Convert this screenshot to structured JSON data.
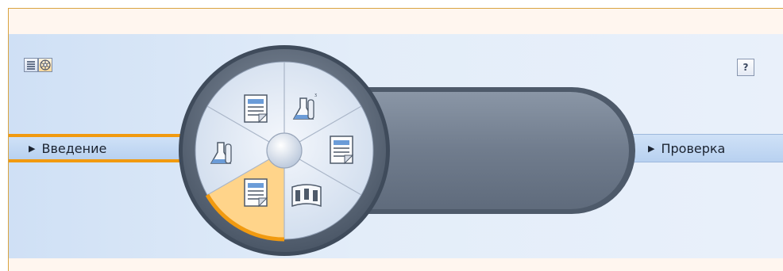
{
  "toolbar": {
    "list_view": "list-view",
    "wheel_view": "wheel-view"
  },
  "help_label": "?",
  "nav": {
    "left_label": "Введение",
    "right_label": "Проверка"
  },
  "wheel": {
    "segments": [
      {
        "icon": "document-icon",
        "state": "normal"
      },
      {
        "icon": "flask-icon",
        "state": "normal"
      },
      {
        "icon": "document-icon",
        "state": "normal"
      },
      {
        "icon": "film-icon",
        "state": "normal"
      },
      {
        "icon": "document-icon",
        "state": "selected"
      },
      {
        "icon": "flask-icon",
        "state": "normal"
      }
    ],
    "progress_fraction": 0.16
  },
  "colors": {
    "accent": "#f19a10",
    "selected_segment": "#ffd48a",
    "hub_dark": "#556273",
    "panel": "#e3edf9"
  }
}
